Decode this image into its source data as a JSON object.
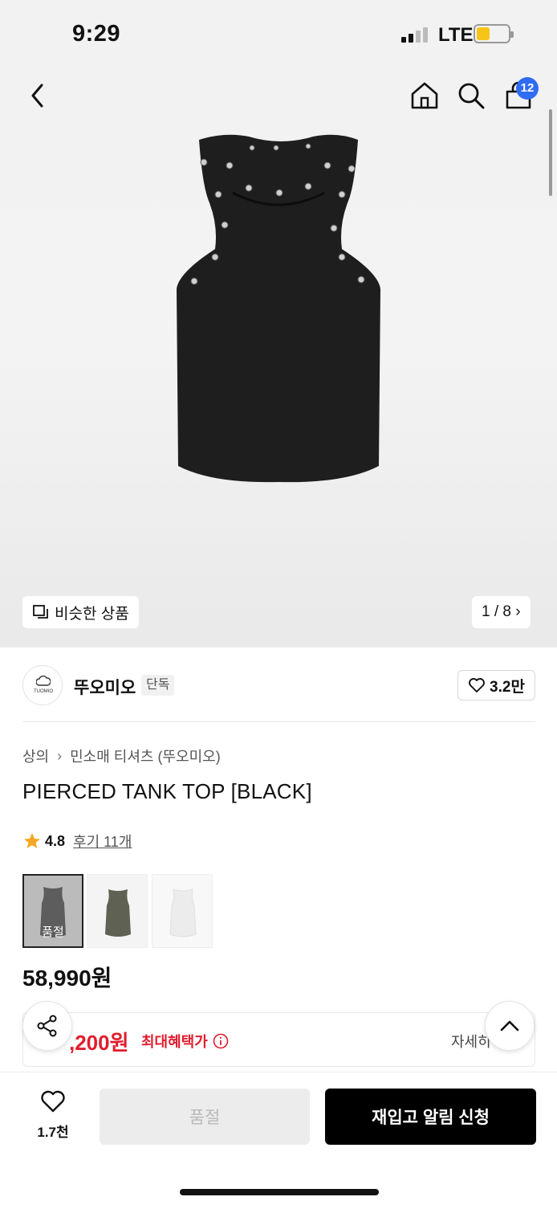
{
  "status": {
    "time": "9:29",
    "carrier": "LTE"
  },
  "header": {
    "cart_count": "12"
  },
  "gallery": {
    "similar_label": "비슷한 상품",
    "page_indicator": "1 / 8 ›"
  },
  "brand": {
    "name": "뚜오미오",
    "tag": "단독",
    "logo_text": "TUOMIO",
    "like_count": "3.2만"
  },
  "breadcrumb": {
    "category": "상의",
    "separator": "›",
    "subcategory": "민소매 티셔츠 (뚜오미오)"
  },
  "product": {
    "title": "PIERCED TANK TOP [BLACK]",
    "rating": "4.8",
    "reviews": "후기 11개",
    "price": "58,990원",
    "swatches": [
      {
        "color": "black",
        "soldout_label": "품절"
      },
      {
        "color": "olive"
      },
      {
        "color": "white"
      }
    ]
  },
  "benefit": {
    "price": ",200원",
    "label": "최대혜택가",
    "detail": "자세히"
  },
  "bottom": {
    "wish_count": "1.7천",
    "soldout_label": "품절",
    "restock_label": "재입고 알림 신청"
  },
  "colors": {
    "accent_red": "#e01d2d",
    "badge_blue": "#2f6cf5"
  }
}
